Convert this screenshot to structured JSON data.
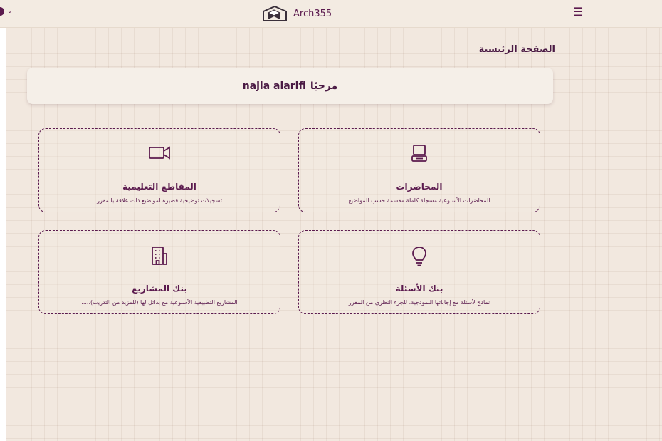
{
  "header": {
    "brand_name": "Arch355",
    "menu_icon": "hamburger-menu-icon",
    "logo_icon": "cube-logo-icon"
  },
  "page": {
    "title": "الصفحة الرئيسية"
  },
  "welcome": {
    "greeting": "مرحبًا",
    "user_name": "najla alarifi"
  },
  "cards": [
    {
      "title": "المحاضرات",
      "description": "المحاضرات الأسبوعية مسجلة كاملة مقسمة حسب المواضيع",
      "icon": "computer-icon"
    },
    {
      "title": "المقاطع التعليمية",
      "description": "تسجيلات توضيحية قصيرة لمواضيع ذات علاقة بالمقرر",
      "icon": "video-camera-icon"
    },
    {
      "title": "بنك الأسئلة",
      "description": "نماذج لأسئلة مع إجاباتها النموذجية، للجزء النظري من المقرر",
      "icon": "lightbulb-icon"
    },
    {
      "title": "بنك المشاريع",
      "description": "المشاريع التطبيقية الأسبوعية مع بدائل لها (للمزيد من التدريب).....",
      "icon": "building-icon"
    }
  ],
  "colors": {
    "primary": "#5b1a4e",
    "background": "#f2e8df",
    "header": "#f3ebe2"
  }
}
